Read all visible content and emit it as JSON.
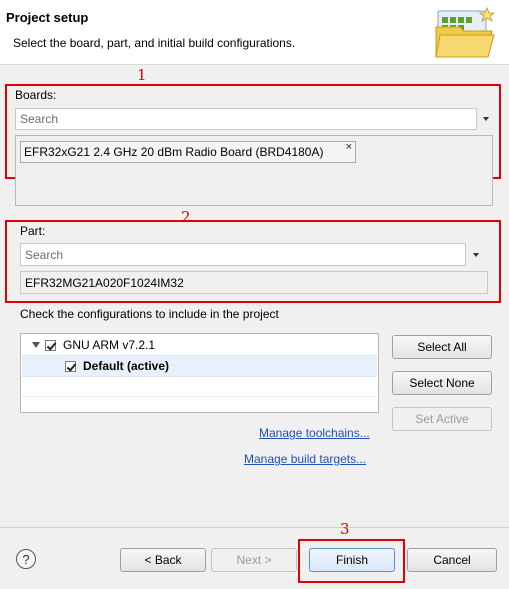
{
  "header": {
    "title": "Project setup",
    "description": "Select the board, part, and initial build configurations."
  },
  "annotations": {
    "one": "1",
    "two": "2",
    "three": "3",
    "color": "#e00000"
  },
  "boards": {
    "label": "Boards:",
    "search_placeholder": "Search",
    "selected": "EFR32xG21 2.4 GHz 20 dBm Radio Board (BRD4180A)",
    "remove_glyph": "×"
  },
  "part": {
    "label": "Part:",
    "search_placeholder": "Search",
    "value": "EFR32MG21A020F1024IM32"
  },
  "configs": {
    "label": "Check the configurations to include in the project",
    "tree": [
      {
        "label": "GNU ARM v7.2.1",
        "checked": true,
        "expanded": true
      },
      {
        "label": "Default (active)",
        "checked": true,
        "bold": true
      }
    ]
  },
  "side_buttons": {
    "select_all": "Select All",
    "select_none": "Select None",
    "set_active": "Set Active"
  },
  "links": {
    "manage_toolchains": "Manage toolchains...",
    "manage_build_targets": "Manage build targets..."
  },
  "footer": {
    "help_glyph": "?",
    "back": "< Back",
    "next": "Next >",
    "finish": "Finish",
    "cancel": "Cancel"
  }
}
